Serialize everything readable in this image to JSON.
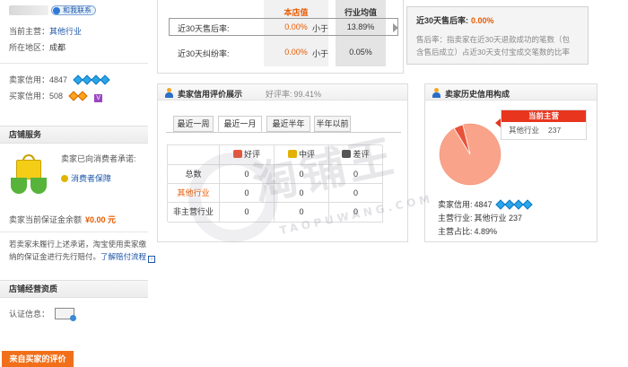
{
  "left": {
    "contact_label": "和我联系",
    "main_category_label": "当前主营：",
    "main_category_value": "其他行业",
    "location_label": "所在地区：",
    "location_value": "成都",
    "seller_credit_label": "卖家信用：",
    "seller_credit_value": "4847",
    "buyer_credit_label": "买家信用：",
    "buyer_credit_value": "508",
    "buyer_badge": "V",
    "store_service_title": "店铺服务",
    "promise_text": "卖家已向消费者承诺:",
    "consumer_protection": "消费者保障",
    "deposit_label": "卖家当前保证金余额",
    "deposit_value": "¥0.00 元",
    "payout_note_1": "若卖家未履行上述承诺，淘宝使用卖家缴",
    "payout_note_2": "纳的保证金进行先行赔付。",
    "payout_link": "了解赔付流程",
    "store_qual_title": "店铺经营资质",
    "cert_label": "认证信息：",
    "bottom_button": "来自买家的评价"
  },
  "stats": {
    "col_store": "本店值",
    "col_avg": "行业均值",
    "rows": [
      {
        "label": "近30天售后率:",
        "store": "0.00%",
        "cmp": "小于",
        "avg": "13.89%"
      },
      {
        "label": "近30天纠纷率:",
        "store": "0.00%",
        "cmp": "小于",
        "avg": "0.05%"
      }
    ],
    "info_title": "近30天售后率:",
    "info_value": "0.00%",
    "info_desc_1": "售后率：指卖家在近30天退款成功的笔数（包",
    "info_desc_2": "含售后成立）占近30天支付宝成交笔数的比率"
  },
  "rating": {
    "title": "卖家信用评价展示",
    "good_rate_label": "好评率:",
    "good_rate_value": "99.41%",
    "tabs": [
      "最近一周",
      "最近一月",
      "最近半年",
      "半年以前"
    ],
    "active_tab": 1,
    "cols": [
      "好评",
      "中评",
      "差评"
    ],
    "rows": [
      {
        "label": "总数",
        "values": [
          "0",
          "0",
          "0"
        ]
      },
      {
        "label": "其他行业",
        "values": [
          "0",
          "0",
          "0"
        ]
      },
      {
        "label": "非主营行业",
        "values": [
          "0",
          "0",
          "0"
        ]
      }
    ]
  },
  "history": {
    "title": "卖家历史信用构成",
    "tooltip_title": "当前主营",
    "tooltip_category": "其他行业",
    "tooltip_value": "237",
    "credit_label": "卖家信用:",
    "credit_value": "4847",
    "main_label": "主营行业:",
    "main_value": "其他行业 237",
    "share_label": "主营占比:",
    "share_value": "4.89%",
    "main_share": 0.0489
  },
  "watermark": {
    "text": "淘铺王",
    "sub": "TAOPUWANG.COM"
  },
  "colors": {
    "accent": "#e95a00",
    "link": "#1d56a8",
    "pie": "#f9a48a",
    "pie_slice": "#e8523a"
  }
}
